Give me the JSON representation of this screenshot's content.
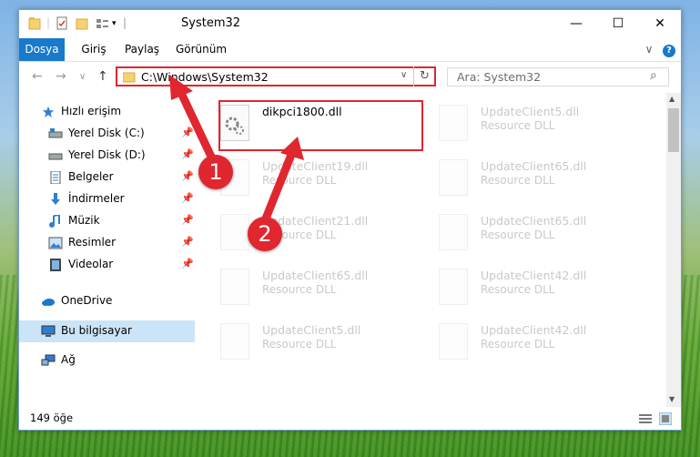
{
  "window": {
    "title": "System32",
    "minimize_glyph": "—",
    "maximize_glyph": "☐",
    "close_glyph": "✕"
  },
  "ribbon": {
    "tabs": [
      "Dosya",
      "Giriş",
      "Paylaş",
      "Görünüm"
    ],
    "help_glyph": "?",
    "collapse_glyph": "∨"
  },
  "nav": {
    "back_glyph": "←",
    "forward_glyph": "→",
    "recent_glyph": "∨",
    "up_glyph": "↑",
    "address": "C:\\Windows\\System32",
    "refresh_glyph": "↻",
    "dropdown_glyph": "∨",
    "search_placeholder": "Ara: System32",
    "search_glyph": "⌕"
  },
  "sidebar": {
    "items": [
      {
        "label": "Hızlı erişim",
        "icon": "star-icon"
      },
      {
        "label": "Yerel Disk (C:)",
        "icon": "drive-icon",
        "pinned": true
      },
      {
        "label": "Yerel Disk (D:)",
        "icon": "drive-icon",
        "pinned": true
      },
      {
        "label": "Belgeler",
        "icon": "document-icon",
        "pinned": true
      },
      {
        "label": "İndirmeler",
        "icon": "download-icon",
        "pinned": true
      },
      {
        "label": "Müzik",
        "icon": "music-icon",
        "pinned": true
      },
      {
        "label": "Resimler",
        "icon": "pictures-icon",
        "pinned": true
      },
      {
        "label": "Videolar",
        "icon": "video-icon",
        "pinned": true
      },
      {
        "label": "OneDrive",
        "icon": "cloud-icon"
      },
      {
        "label": "Bu bilgisayar",
        "icon": "computer-icon",
        "selected": true
      },
      {
        "label": "Ağ",
        "icon": "network-icon"
      }
    ],
    "pin_glyph": "📌"
  },
  "files": [
    {
      "name": "dikpci1800.dll",
      "type": ""
    },
    {
      "name": "UpdateClient5.dll",
      "type": "Resource DLL"
    },
    {
      "name": "UpdateClient19.dll",
      "type": "Resource DLL"
    },
    {
      "name": "UpdateClient65.dll",
      "type": "Resource DLL"
    },
    {
      "name": "UpdateClient21.dll",
      "type": "Resource DLL"
    },
    {
      "name": "UpdateClient65.dll",
      "type": "Resource DLL"
    },
    {
      "name": "UpdateClient65.dll",
      "type": "Resource DLL"
    },
    {
      "name": "UpdateClient42.dll",
      "type": "Resource DLL"
    },
    {
      "name": "UpdateClient5.dll",
      "type": "Resource DLL"
    },
    {
      "name": "UpdateClient42.dll",
      "type": "Resource DLL"
    }
  ],
  "status": {
    "item_count": "149 öğe"
  },
  "annotations": {
    "step1": "1",
    "step2": "2",
    "color": "#e0262e"
  }
}
